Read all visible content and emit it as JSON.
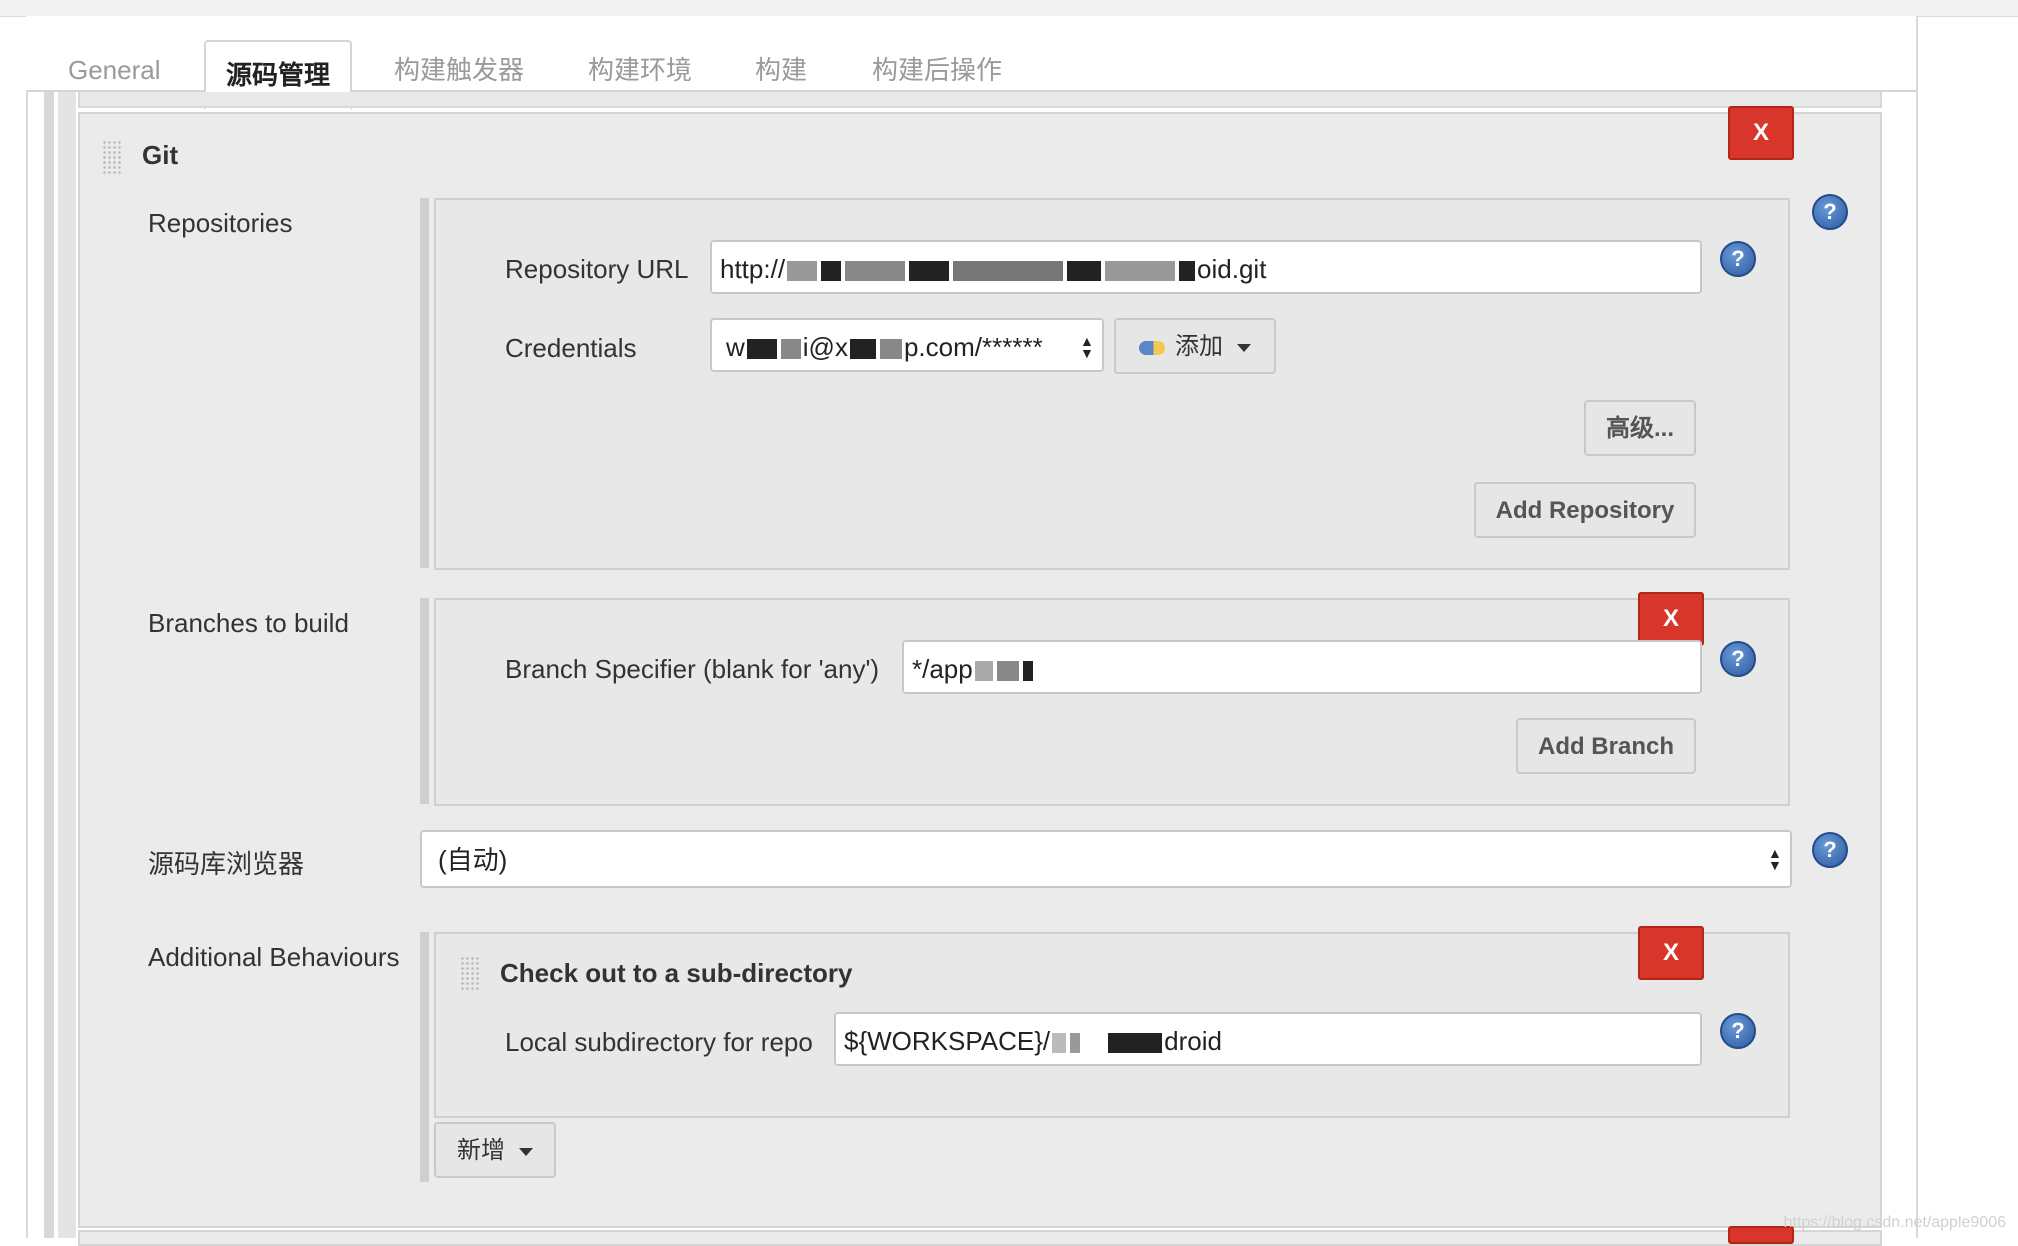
{
  "tabs": [
    {
      "label": "General"
    },
    {
      "label": "源码管理"
    },
    {
      "label": "构建触发器"
    },
    {
      "label": "构建环境"
    },
    {
      "label": "构建"
    },
    {
      "label": "构建后操作"
    }
  ],
  "active_tab": "源码管理",
  "git": {
    "title": "Git",
    "delete_label": "X"
  },
  "repositories": {
    "label": "Repositories",
    "url_label": "Repository URL",
    "url_value_start": "http://",
    "url_value_end": "oid.git",
    "credentials_label": "Credentials",
    "credentials_value_start": "w",
    "credentials_value_mid": "i@x",
    "credentials_value_end": "p.com/******",
    "add_label": "添加",
    "advanced_label": "高级...",
    "add_repository_label": "Add Repository"
  },
  "branches": {
    "label": "Branches to build",
    "specifier_label": "Branch Specifier (blank for 'any')",
    "specifier_value": "*/app",
    "delete_label": "X",
    "add_branch_label": "Add Branch"
  },
  "browser": {
    "label": "源码库浏览器",
    "selected": "(自动)"
  },
  "behaviours": {
    "label": "Additional Behaviours",
    "item_title": "Check out to a sub-directory",
    "delete_label": "X",
    "subdir_label": "Local subdirectory for repo",
    "subdir_value_start": "${WORKSPACE}/",
    "subdir_value_end": "droid",
    "add_label": "新增"
  },
  "help_glyph": "?",
  "watermark": "https://blog.csdn.net/apple9006",
  "colors": {
    "delete_red": "#d9362b",
    "help_blue": "#2c5aa0",
    "panel_gray": "#ebebeb"
  }
}
